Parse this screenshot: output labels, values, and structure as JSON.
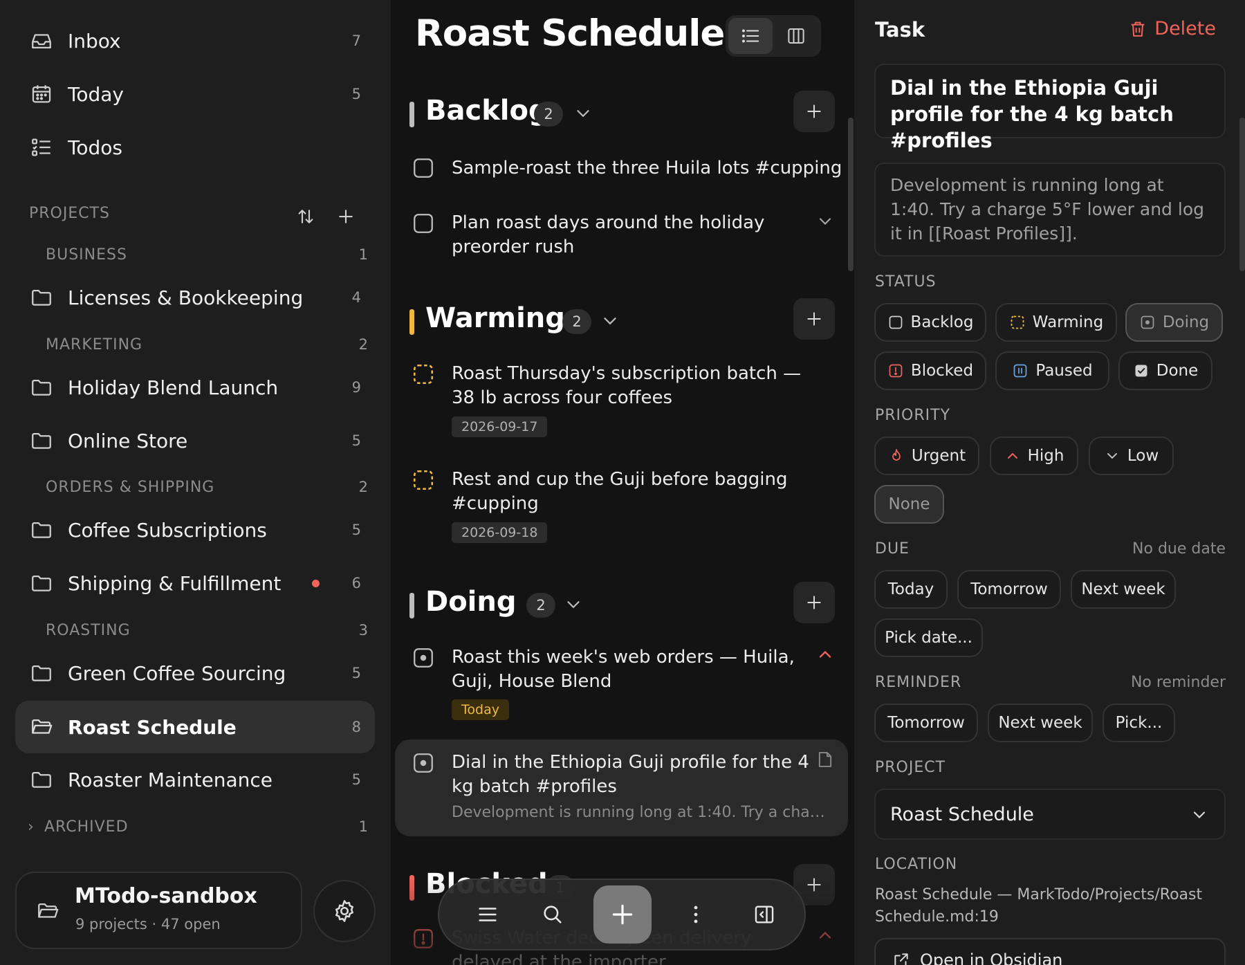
{
  "sidebar": {
    "nav": [
      {
        "label": "Inbox",
        "count": "7",
        "icon": "inbox-icon"
      },
      {
        "label": "Today",
        "count": "5",
        "icon": "calendar-icon"
      },
      {
        "label": "Todos",
        "count": "",
        "icon": "checklist-icon"
      }
    ],
    "projects_heading": "PROJECTS",
    "groups": [
      {
        "name": "BUSINESS",
        "count": "1"
      },
      {
        "name": "MARKETING",
        "count": "2"
      },
      {
        "name": "ORDERS & SHIPPING",
        "count": "2"
      },
      {
        "name": "ROASTING",
        "count": "3"
      }
    ],
    "projects": [
      {
        "label": "Licenses & Bookkeeping",
        "count": "4"
      },
      {
        "label": "Holiday Blend Launch",
        "count": "9"
      },
      {
        "label": "Online Store",
        "count": "5"
      },
      {
        "label": "Coffee Subscriptions",
        "count": "5"
      },
      {
        "label": "Shipping & Fulfillment",
        "count": "6"
      },
      {
        "label": "Green Coffee Sourcing",
        "count": "5"
      },
      {
        "label": "Roast Schedule",
        "count": "8"
      },
      {
        "label": "Roaster Maintenance",
        "count": "5"
      }
    ],
    "archived": {
      "label": "ARCHIVED",
      "count": "1"
    },
    "workspace": {
      "name": "MTodo-sandbox",
      "summary": "9 projects · 47 open"
    }
  },
  "board": {
    "title": "Roast Schedule",
    "columns": [
      {
        "name": "Backlog",
        "count": "2",
        "color": "#bdbdbd"
      },
      {
        "name": "Warming",
        "count": "2",
        "color": "#f0b840"
      },
      {
        "name": "Doing",
        "count": "2",
        "color": "#bdbdbd"
      },
      {
        "name": "Blocked",
        "count": "1",
        "color": "#f0645c"
      }
    ],
    "tasks": [
      {
        "title": "Sample-roast the three Huila lots #cupping"
      },
      {
        "title": "Plan roast days around the holiday preorder rush"
      },
      {
        "title": "Roast Thursday's subscription batch — 38 lb across four coffees",
        "date": "2026-09-17"
      },
      {
        "title": "Rest and cup the Guji before bagging #cupping",
        "date": "2026-09-18"
      },
      {
        "title": "Roast this week's web orders — Huila, Guji, House Blend",
        "date": "Today"
      },
      {
        "title": "Dial in the Ethiopia Guji profile for the 4 kg batch #profiles",
        "note": "Development is running long at 1:40. Try a charge 5°..."
      },
      {
        "title": "Swiss Water decaf green delivery delayed at the importer"
      }
    ]
  },
  "detail": {
    "heading": "Task",
    "delete_label": "Delete",
    "task_name": "Dial in the Ethiopia Guji profile for the 4 kg batch #profiles",
    "notes": "Development is running long at 1:40. Try a charge 5°F lower and log it in [[Roast Profiles]].",
    "status_label": "STATUS",
    "status_options": [
      "Backlog",
      "Warming",
      "Doing",
      "Blocked",
      "Paused",
      "Done"
    ],
    "status_selected": "Doing",
    "priority_label": "PRIORITY",
    "priority_options": [
      "Urgent",
      "High",
      "Low",
      "None"
    ],
    "priority_selected": "None",
    "due_label": "DUE",
    "due_value": "No due date",
    "due_options": [
      "Today",
      "Tomorrow",
      "Next week",
      "Pick date..."
    ],
    "reminder_label": "REMINDER",
    "reminder_value": "No reminder",
    "reminder_options": [
      "Tomorrow",
      "Next week",
      "Pick..."
    ],
    "project_label": "PROJECT",
    "project_value": "Roast Schedule",
    "location_label": "LOCATION",
    "location_value": "Roast Schedule — MarkTodo/Projects/Roast Schedule.md:19",
    "open_label": "Open in Obsidian"
  },
  "colors": {
    "accent_red": "#f0645c",
    "warming_yellow": "#f0b840",
    "background": "#161616"
  }
}
